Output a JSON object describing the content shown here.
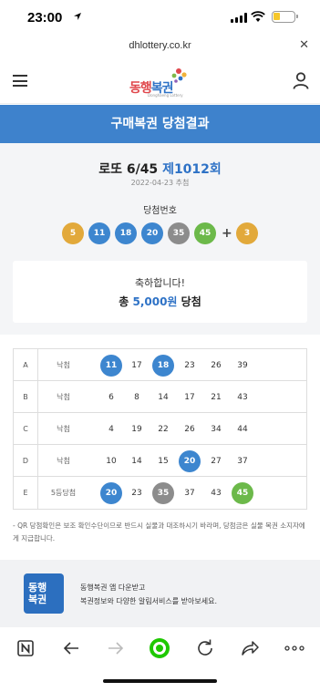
{
  "status_bar": {
    "time": "23:00"
  },
  "browser": {
    "url": "dhlottery.co.kr"
  },
  "header": {
    "logo_text_1": "동행",
    "logo_text_2": "복권",
    "logo_sub": "Donghaeng Lottery"
  },
  "page_title": "구매복권 당첨결과",
  "draw": {
    "name": "로또 6/45",
    "round": "제1012회",
    "date": "2022-04-23 추첨",
    "winning_label": "당첨번호",
    "winning_numbers": [
      5,
      11,
      18,
      20,
      35,
      45
    ],
    "bonus": 3,
    "plus": "+"
  },
  "congrats": {
    "message": "축하합니다!",
    "prefix": "총",
    "amount": "5,000원",
    "suffix": "당첨"
  },
  "ball_colors": {
    "yellow": "#e2a93b",
    "blue": "#3d86cf",
    "gray": "#8c8c8c",
    "green": "#6cb94a"
  },
  "games": [
    {
      "label": "A",
      "result": "낙첨",
      "numbers": [
        11,
        17,
        18,
        23,
        26,
        39
      ],
      "hits": [
        "blue",
        null,
        "blue",
        null,
        null,
        null
      ]
    },
    {
      "label": "B",
      "result": "낙첨",
      "numbers": [
        6,
        8,
        14,
        17,
        21,
        43
      ],
      "hits": [
        null,
        null,
        null,
        null,
        null,
        null
      ]
    },
    {
      "label": "C",
      "result": "낙첨",
      "numbers": [
        4,
        19,
        22,
        26,
        34,
        44
      ],
      "hits": [
        null,
        null,
        null,
        null,
        null,
        null
      ]
    },
    {
      "label": "D",
      "result": "낙첨",
      "numbers": [
        10,
        14,
        15,
        20,
        27,
        37
      ],
      "hits": [
        null,
        null,
        null,
        "blue",
        null,
        null
      ]
    },
    {
      "label": "E",
      "result": "5등당첨",
      "numbers": [
        20,
        23,
        35,
        37,
        43,
        45
      ],
      "hits": [
        "blue",
        null,
        "gray",
        null,
        null,
        "green"
      ]
    }
  ],
  "qr_note": "- QR 당첨확인은 보조 확인수단이므로 반드시 실물과 대조하시기 바라며, 당첨금은 실물 복권 소지자에게 지급합니다.",
  "banner": {
    "app_icon_text_1": "동행",
    "app_icon_text_2": "복권",
    "line1": "동행복권 앱 다운받고",
    "line2": "복권정보와 다양한 알림서비스를 받아보세요."
  },
  "toolbar": {
    "n_label": "N"
  }
}
